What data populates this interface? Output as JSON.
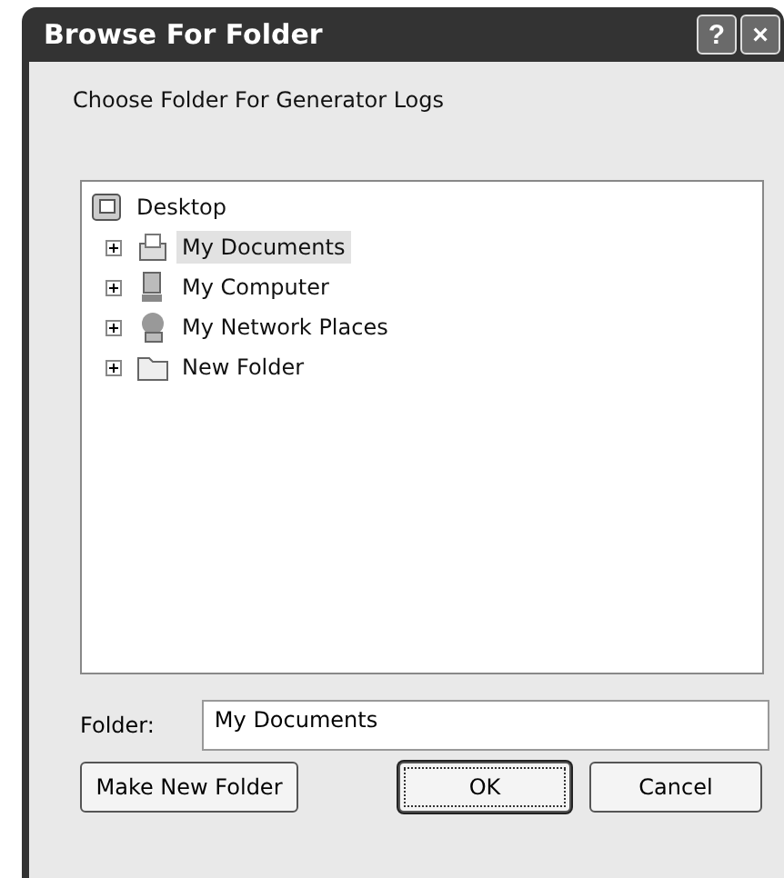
{
  "window": {
    "title": "Browse For Folder",
    "buttons": [
      "?",
      "×"
    ]
  },
  "description": "Choose Folder For Generator Logs",
  "tree": [
    {
      "label": "Desktop",
      "kind": "desktop",
      "selected": false,
      "expanded": true,
      "children": [
        {
          "label": "My Documents",
          "kind": "documents",
          "selected": true,
          "expanded": false
        },
        {
          "label": "My Computer",
          "kind": "computer",
          "selected": false,
          "expanded": false
        },
        {
          "label": "My Network Places",
          "kind": "network",
          "selected": false,
          "expanded": false
        },
        {
          "label": "New Folder",
          "kind": "folder",
          "selected": false,
          "expanded": false
        }
      ]
    }
  ],
  "folder_field": {
    "label": "Folder:",
    "value": "My Documents"
  },
  "buttons": [
    {
      "label": "Make New Folder",
      "default": false
    },
    {
      "label": "OK",
      "default": true
    },
    {
      "label": "Cancel",
      "default": false
    }
  ]
}
